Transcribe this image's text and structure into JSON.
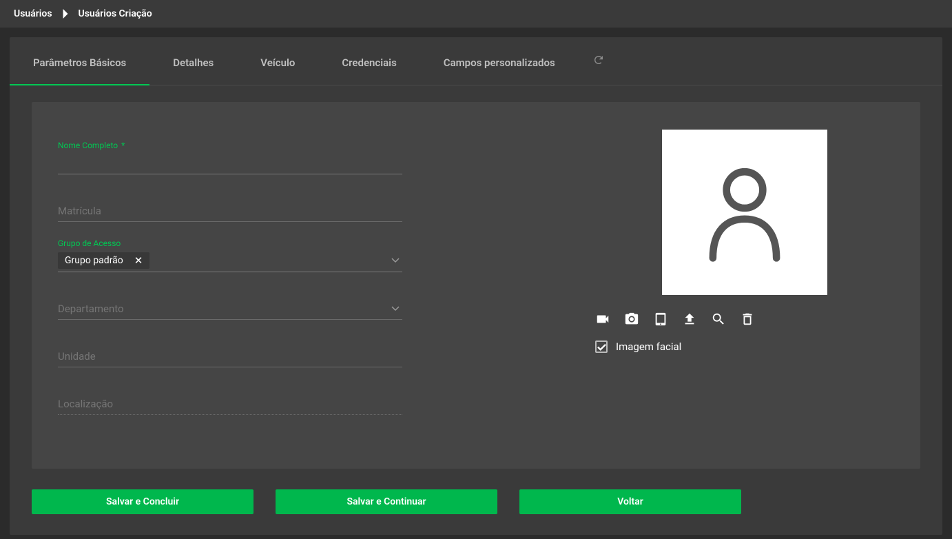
{
  "breadcrumb": {
    "root": "Usuários",
    "current": "Usuários Criação"
  },
  "tabs": {
    "basic": "Parâmetros Básicos",
    "details": "Detalhes",
    "vehicle": "Veículo",
    "credentials": "Credenciais",
    "custom": "Campos personalizados"
  },
  "fields": {
    "name_label": "Nome Completo",
    "name_required": "*",
    "matricula_placeholder": "Matrícula",
    "grupo_label": "Grupo de Acesso",
    "grupo_chip": "Grupo padrão",
    "departamento_placeholder": "Departamento",
    "unidade_placeholder": "Unidade",
    "localizacao_placeholder": "Localização"
  },
  "photo": {
    "facial_label": "Imagem facial"
  },
  "buttons": {
    "save_finish": "Salvar e Concluir",
    "save_continue": "Salvar e Continuar",
    "back": "Voltar"
  }
}
